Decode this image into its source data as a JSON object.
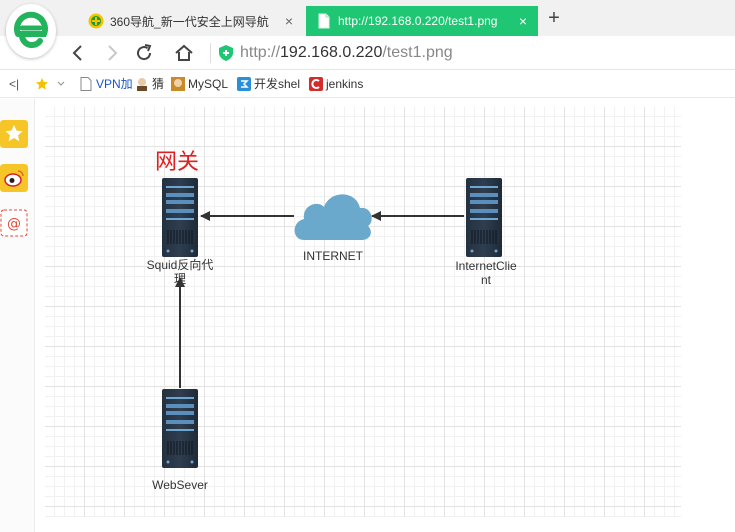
{
  "browser": {
    "tabs": [
      {
        "title": "360导航_新一代安全上网导航",
        "close": "×",
        "active": false
      },
      {
        "title": "http://192.168.0.220/test1.png",
        "close": "×",
        "active": true
      }
    ],
    "new_tab": "+",
    "url": {
      "scheme": "http://",
      "host": "192.168.0.220",
      "path": "/test1.png"
    },
    "accent_color": "#1fc673"
  },
  "bookmarks": [
    {
      "label": "VPN加",
      "icon": "page-icon"
    },
    {
      "label": "猜",
      "icon": "avatar-icon"
    },
    {
      "label": "MySQL",
      "icon": "avatar-icon"
    },
    {
      "label": "开发shel",
      "icon": "app-icon"
    },
    {
      "label": "jenkins",
      "icon": "c-logo-icon"
    }
  ],
  "bookmarks_toggle": "<|",
  "diagram": {
    "title": "网关",
    "nodes": {
      "squid": {
        "label_line1": "Squid反向代",
        "label_line2": "理"
      },
      "client": {
        "label_line1": "InternetClie",
        "label_line2": "nt"
      },
      "webserver": {
        "label": "WebSever"
      },
      "internet": {
        "label": "INTERNET"
      }
    },
    "edges": [
      {
        "from": "InternetClient",
        "to": "INTERNET"
      },
      {
        "from": "INTERNET",
        "to": "Squid反向代理"
      },
      {
        "from": "WebSever",
        "to": "Squid反向代理"
      }
    ]
  }
}
